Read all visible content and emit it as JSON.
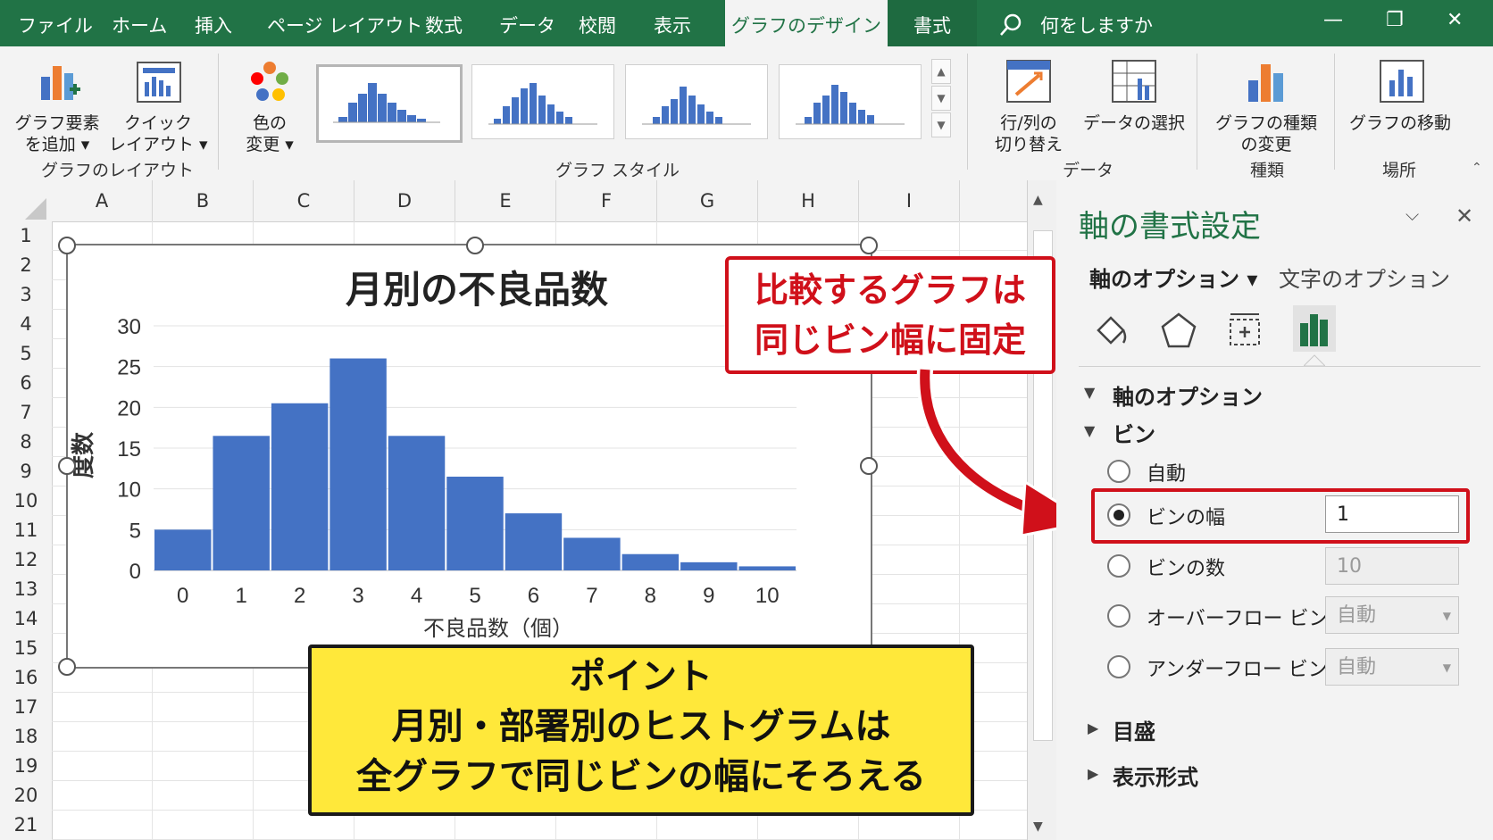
{
  "tabs": [
    "ファイル",
    "ホーム",
    "挿入",
    "ページ レイアウト",
    "数式",
    "データ",
    "校閲",
    "表示",
    "グラフのデザイン",
    "書式"
  ],
  "active_tab": "グラフのデザイン",
  "tell_me": "何をしますか",
  "window_controls": {
    "minimize": "—",
    "restore": "❐",
    "close": "✕"
  },
  "ribbon": {
    "add_element": [
      "グラフ要素",
      "を追加 ▾"
    ],
    "quick_layout": [
      "クイック",
      "レイアウト ▾"
    ],
    "change_colors": [
      "色の",
      "変更 ▾"
    ],
    "group_layout": "グラフのレイアウト",
    "group_styles": "グラフ スタイル",
    "switch_row_col": [
      "行/列の",
      "切り替え"
    ],
    "select_data": "データの選択",
    "group_data": "データ",
    "change_type": [
      "グラフの種類",
      "の変更"
    ],
    "group_type": "種類",
    "move_chart": "グラフの移動",
    "group_location": "場所"
  },
  "columns": [
    "A",
    "B",
    "C",
    "D",
    "E",
    "F",
    "G",
    "H",
    "I"
  ],
  "rows": [
    "1",
    "2",
    "3",
    "4",
    "5",
    "6",
    "7",
    "8",
    "9",
    "10",
    "11",
    "12",
    "13",
    "14",
    "15",
    "16",
    "17",
    "18",
    "19",
    "20",
    "21"
  ],
  "chart_data": {
    "type": "bar",
    "title": "月別の不良品数",
    "xlabel": "不良品数（個）",
    "ylabel": "度数",
    "categories": [
      "0",
      "1",
      "2",
      "3",
      "4",
      "5",
      "6",
      "7",
      "8",
      "9",
      "10"
    ],
    "values": [
      5,
      16.5,
      20.5,
      26,
      16.5,
      11.5,
      7,
      4,
      2,
      1,
      0.5
    ],
    "yticks": [
      "0",
      "5",
      "10",
      "15",
      "20",
      "25",
      "30"
    ],
    "ylim": [
      0,
      30
    ],
    "color": "#4472c4",
    "grid": true
  },
  "red_callout": [
    "比較するグラフは",
    "同じビン幅に固定"
  ],
  "point_box": [
    "ポイント",
    "月別・部署別のヒストグラムは",
    "全グラフで同じビンの幅にそろえる"
  ],
  "pane": {
    "title": "軸の書式設定",
    "tab_axis": "軸のオプション ▾",
    "tab_text": "文字のオプション",
    "section_axis": "軸のオプション",
    "section_bin": "ビン",
    "auto": "自動",
    "bin_width": "ビンの幅",
    "bin_width_value": "1",
    "bin_count": "ビンの数",
    "bin_count_value": "10",
    "overflow": "オーバーフロー ビン",
    "overflow_value": "自動",
    "underflow": "アンダーフロー ビン",
    "underflow_value": "自動",
    "ticks": "目盛",
    "number_format": "表示形式"
  }
}
